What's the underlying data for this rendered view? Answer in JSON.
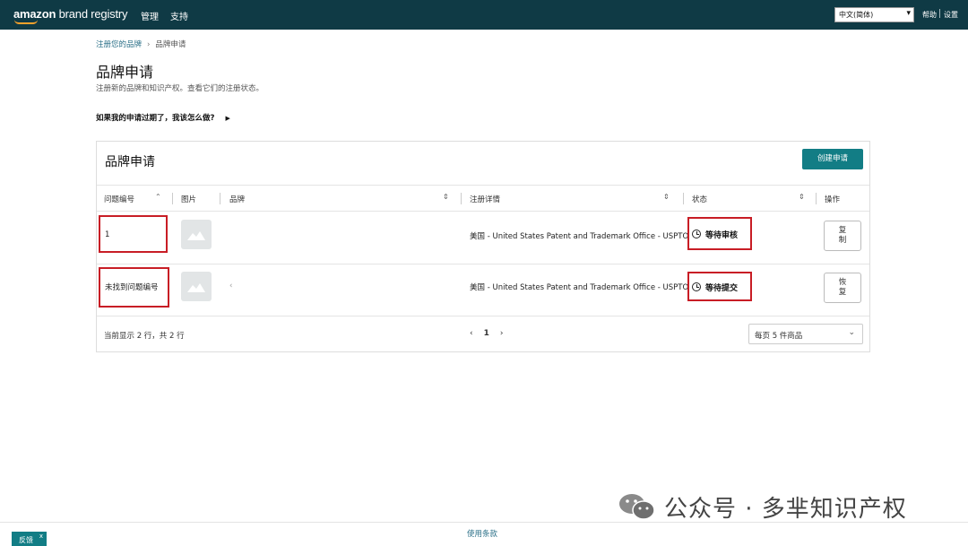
{
  "topbar": {
    "logo_main": "amazon",
    "logo_sub": " brand registry",
    "nav": [
      "管理",
      "支持"
    ],
    "language": "中文(简体)",
    "help": "帮助",
    "settings": "设置",
    "bg_color": "#0f3a45"
  },
  "breadcrumb": {
    "parent": "注册您的品牌",
    "current": "品牌申请"
  },
  "header": {
    "title": "品牌申请",
    "subtitle": "注册新的品牌和知识产权。查看它们的注册状态。",
    "faq": "如果我的申请过期了，我该怎么做?"
  },
  "card": {
    "title": "品牌申请",
    "create_button": "创建申请",
    "columns": [
      "问题编号",
      "图片",
      "品牌",
      "注册详情",
      "状态",
      "操作"
    ],
    "rows": [
      {
        "id": "1",
        "brand": "",
        "details": "美国 - United States Patent and Trademark Office - USPTO",
        "status": "等待审核",
        "action_line1": "复",
        "action_line2": "制"
      },
      {
        "id": "未找到问题编号",
        "brand": "‹",
        "details": "美国 - United States Patent and Trademark Office - USPTO",
        "status": "等待提交",
        "action_line1": "恢",
        "action_line2": "复"
      }
    ],
    "showing": "当前显示 2 行，共 2 行",
    "page": "1",
    "per_page": "每页 5 件商品"
  },
  "watermark": "公众号 · 多芈知识产权",
  "footer": {
    "terms": "使用条款",
    "feedback": "反馈"
  },
  "accent_color": "#127d85",
  "highlight_color": "#c81d25"
}
